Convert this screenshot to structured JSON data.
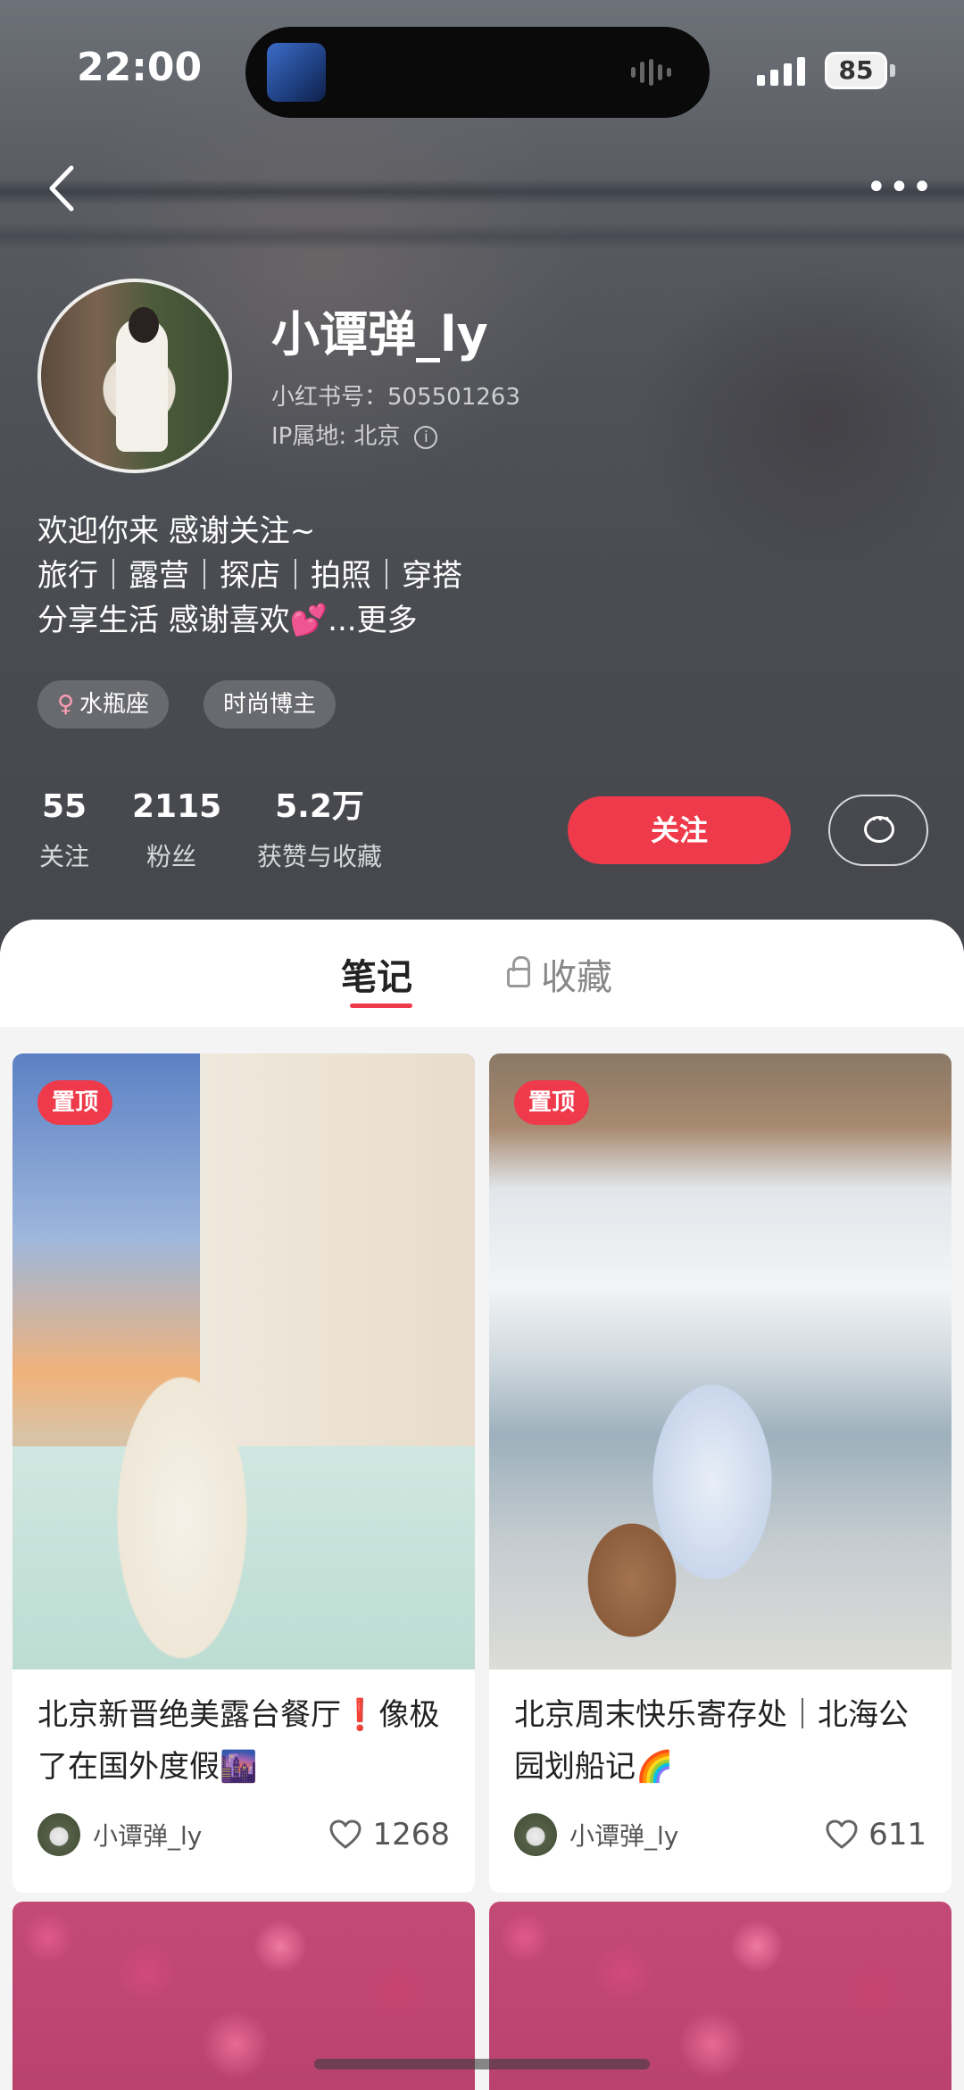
{
  "status_bar": {
    "time": "22:00",
    "battery": "85"
  },
  "profile": {
    "nickname": "小谭弹_ly",
    "red_id": "小红书号：505501263",
    "ip_location": "IP属地: 北京",
    "bio_lines": [
      "欢迎你来 感谢关注~",
      "旅行｜露营｜探店｜拍照｜穿搭",
      "分享生活 感谢喜欢💕"
    ],
    "bio_more": "...更多",
    "tags": [
      {
        "icon": "female-icon",
        "label": "水瓶座"
      },
      {
        "label": "时尚博主"
      }
    ],
    "stats": [
      {
        "value": "55",
        "label": "关注"
      },
      {
        "value": "2115",
        "label": "粉丝"
      },
      {
        "value": "5.2万",
        "label": "获赞与收藏"
      }
    ],
    "follow_label": "关注",
    "message_icon": "chat-bubble-icon"
  },
  "tabs": {
    "notes": "笔记",
    "favorites": "收藏",
    "active": "notes"
  },
  "notes": [
    {
      "pinned_label": "置顶",
      "title": "北京新晋绝美露台餐厅❗️像极了在国外度假🌆",
      "author": "小谭弹_ly",
      "likes": "1268"
    },
    {
      "pinned_label": "置顶",
      "title": "北京周末快乐寄存处｜北海公园划船记🌈",
      "author": "小谭弹_ly",
      "likes": "611"
    }
  ],
  "colors": {
    "accent": "#ee3a4a",
    "header_bg": "#4f5258"
  }
}
